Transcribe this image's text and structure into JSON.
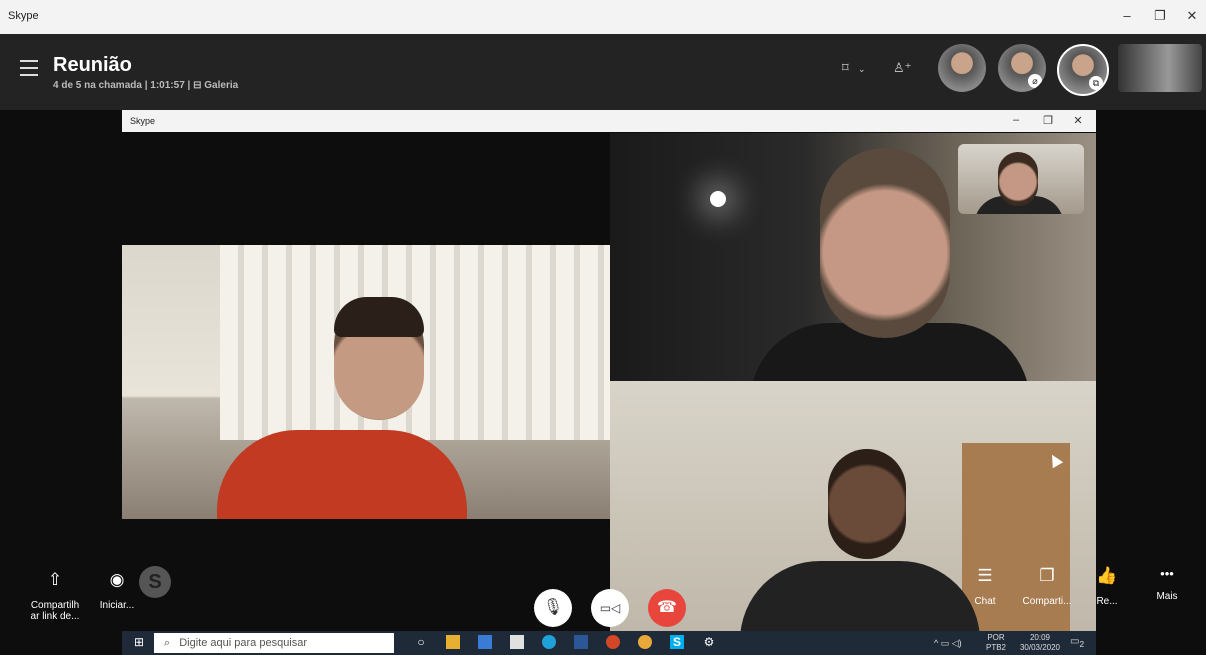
{
  "window": {
    "title": "Skype",
    "min": "–",
    "max": "❐",
    "close": "✕"
  },
  "meeting": {
    "title": "Reunião",
    "subtitle": "4 de 5 na chamada | 1:01:57  |  ⊟ Galeria"
  },
  "header_icons": {
    "layout": "⌑",
    "chevron": "⌄",
    "add_person": "♙⁺"
  },
  "inner_window": {
    "title": "Skype",
    "min": "–",
    "max": "❐",
    "close": "✕"
  },
  "actions_left": [
    {
      "icon": "share-icon",
      "glyph": "⇧",
      "label": "Compartilh ar link de..."
    },
    {
      "icon": "record-icon",
      "glyph": "◉",
      "label": "Iniciar..."
    }
  ],
  "skype_badge": "S",
  "actions_right": [
    {
      "icon": "chat-icon",
      "glyph": "☰",
      "label": "Chat"
    },
    {
      "icon": "share-screen-icon",
      "glyph": "❐",
      "label": "Comparti..."
    },
    {
      "icon": "react-icon",
      "glyph": "👍",
      "label": "Re..."
    },
    {
      "icon": "more-icon",
      "glyph": "•••",
      "label": "Mais"
    }
  ],
  "call_controls": {
    "mic": "🎙",
    "video": "▭◁",
    "hangup": "☎"
  },
  "colors": {
    "hangup": "#e8453c",
    "header_bg": "#232323",
    "taskbar_bg": "#1f2a38"
  },
  "taskbar": {
    "search_placeholder": "Digite aqui para pesquisar",
    "start": "⊞",
    "search_icon": "⌕",
    "tray_lang": "POR",
    "tray_kbd": "PTB2",
    "time": "20:09",
    "date": "30/03/2020",
    "notif": "2"
  }
}
